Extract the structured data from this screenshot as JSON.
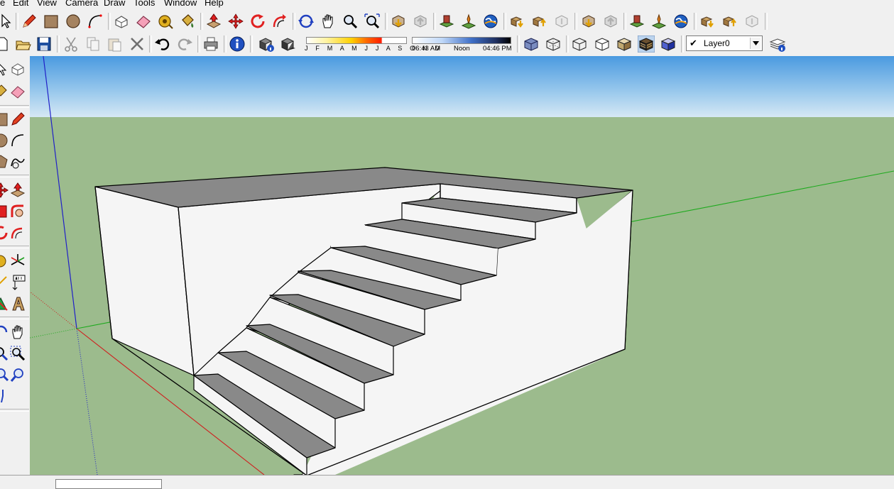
{
  "menubar": {
    "items": [
      {
        "label": "e"
      },
      {
        "label": "Edit"
      },
      {
        "label": "View"
      },
      {
        "label": "Camera"
      },
      {
        "label": "Draw"
      },
      {
        "label": "Tools"
      },
      {
        "label": "Window"
      },
      {
        "label": "Help"
      }
    ]
  },
  "shadow": {
    "months": "J F M A M J J A S O N D",
    "time_start": "06:43 AM",
    "time_noon": "Noon",
    "time_end": "04:46 PM"
  },
  "layers": {
    "current": "Layer0",
    "check": "✔",
    "arrow": "▾"
  },
  "colors": {
    "sky_top": "#4a9ae0",
    "sky_bottom": "#d6e8f4",
    "ground": "#9cbb8d",
    "model_face": "#f5f5f5",
    "tread_face": "#898989",
    "axis_red": "#d01e1e",
    "axis_green": "#1eaa1e",
    "axis_blue": "#2020c8"
  }
}
